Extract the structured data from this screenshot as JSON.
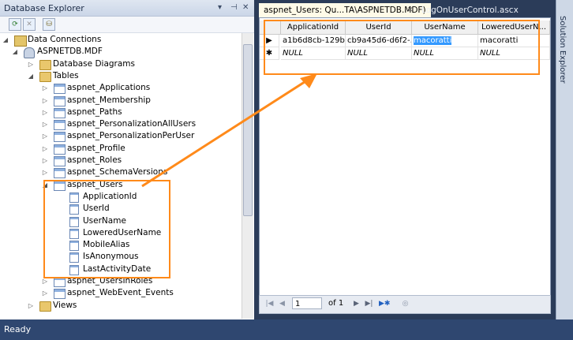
{
  "left_panel": {
    "title": "Database Explorer",
    "title_buttons": [
      "▾",
      "⊣",
      "✕"
    ],
    "tree": [
      {
        "label": "Data Connections",
        "indent": 0,
        "expanded": true,
        "icon": "data-connections-icon"
      },
      {
        "label": "ASPNETDB.MDF",
        "indent": 1,
        "expanded": true,
        "icon": "database-icon"
      },
      {
        "label": "Database Diagrams",
        "indent": 2,
        "expanded": false,
        "icon": "folder-icon"
      },
      {
        "label": "Tables",
        "indent": 2,
        "expanded": true,
        "icon": "folder-icon"
      },
      {
        "label": "aspnet_Applications",
        "indent": 3,
        "expanded": false,
        "icon": "table-icon"
      },
      {
        "label": "aspnet_Membership",
        "indent": 3,
        "expanded": false,
        "icon": "table-icon"
      },
      {
        "label": "aspnet_Paths",
        "indent": 3,
        "expanded": false,
        "icon": "table-icon"
      },
      {
        "label": "aspnet_PersonalizationAllUsers",
        "indent": 3,
        "expanded": false,
        "icon": "table-icon"
      },
      {
        "label": "aspnet_PersonalizationPerUser",
        "indent": 3,
        "expanded": false,
        "icon": "table-icon"
      },
      {
        "label": "aspnet_Profile",
        "indent": 3,
        "expanded": false,
        "icon": "table-icon"
      },
      {
        "label": "aspnet_Roles",
        "indent": 3,
        "expanded": false,
        "icon": "table-icon"
      },
      {
        "label": "aspnet_SchemaVersions",
        "indent": 3,
        "expanded": false,
        "icon": "table-icon"
      },
      {
        "label": "aspnet_Users",
        "indent": 3,
        "expanded": true,
        "icon": "table-icon"
      },
      {
        "label": "ApplicationId",
        "indent": 4,
        "icon": "column-icon"
      },
      {
        "label": "UserId",
        "indent": 4,
        "icon": "column-icon"
      },
      {
        "label": "UserName",
        "indent": 4,
        "icon": "column-icon"
      },
      {
        "label": "LoweredUserName",
        "indent": 4,
        "icon": "column-icon"
      },
      {
        "label": "MobileAlias",
        "indent": 4,
        "icon": "column-icon"
      },
      {
        "label": "IsAnonymous",
        "indent": 4,
        "icon": "column-icon"
      },
      {
        "label": "LastActivityDate",
        "indent": 4,
        "icon": "column-icon"
      },
      {
        "label": "aspnet_UsersInRoles",
        "indent": 3,
        "expanded": false,
        "icon": "table-icon"
      },
      {
        "label": "aspnet_WebEvent_Events",
        "indent": 3,
        "expanded": false,
        "icon": "table-icon"
      },
      {
        "label": "Views",
        "indent": 2,
        "expanded": false,
        "icon": "folder-icon"
      }
    ]
  },
  "tabs": [
    {
      "label": "aspnet_Users: Qu...TA\\ASPNETDB.MDF)",
      "active": true
    },
    {
      "label": "LogOnUserControl.ascx",
      "active": false
    }
  ],
  "grid": {
    "headers": [
      "ApplicationId",
      "UserId",
      "UserName",
      "LoweredUserN..."
    ],
    "rows": [
      [
        "a1b6d8cb-129b...",
        "cb9a45d6-d6f2-...",
        "macoratti",
        "macoratti"
      ],
      [
        "NULL",
        "NULL",
        "NULL",
        "NULL"
      ]
    ]
  },
  "pager": {
    "current_page": "1",
    "of_label": "of 1"
  },
  "side_panel": {
    "label": "Solution Explorer"
  },
  "status": {
    "text": "Ready"
  },
  "colors": {
    "highlight": "#ff8a1a",
    "selection": "#3399ff"
  }
}
